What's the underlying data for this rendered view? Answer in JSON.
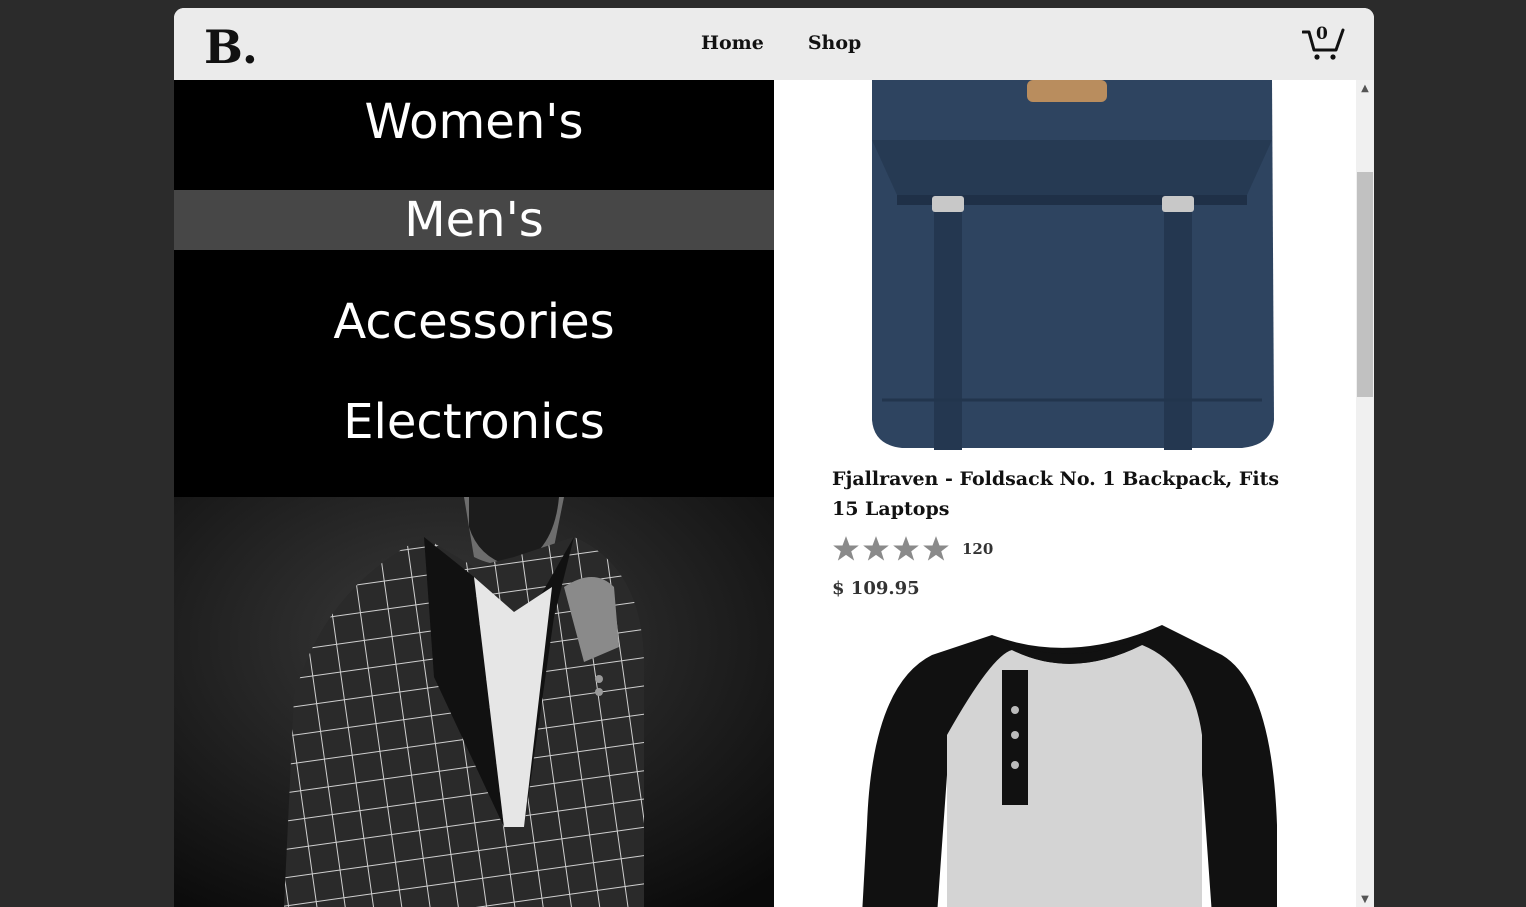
{
  "header": {
    "logo": "B.",
    "nav": [
      {
        "label": "Home"
      },
      {
        "label": "Shop"
      }
    ],
    "cart_count": "0"
  },
  "sidebar": {
    "categories": [
      {
        "label": "Women's",
        "active": false
      },
      {
        "label": "Men's",
        "active": true
      },
      {
        "label": "Accessories",
        "active": false
      },
      {
        "label": "Electronics",
        "active": false
      }
    ]
  },
  "products": [
    {
      "title": "Fjallraven - Foldsack No. 1 Backpack, Fits 15 Laptops",
      "rating_count": "120",
      "rating_stars": 4,
      "price": "$ 109.95",
      "image_icon": "backpack-image"
    },
    {
      "title": "",
      "image_icon": "henley-shirt-image"
    }
  ],
  "colors": {
    "background": "#2b2b2b",
    "topbar": "#ebebeb",
    "sidebar": "#000000",
    "active_category": "#474747",
    "star": "#8a8a8a",
    "backpack": "#2e4460"
  }
}
